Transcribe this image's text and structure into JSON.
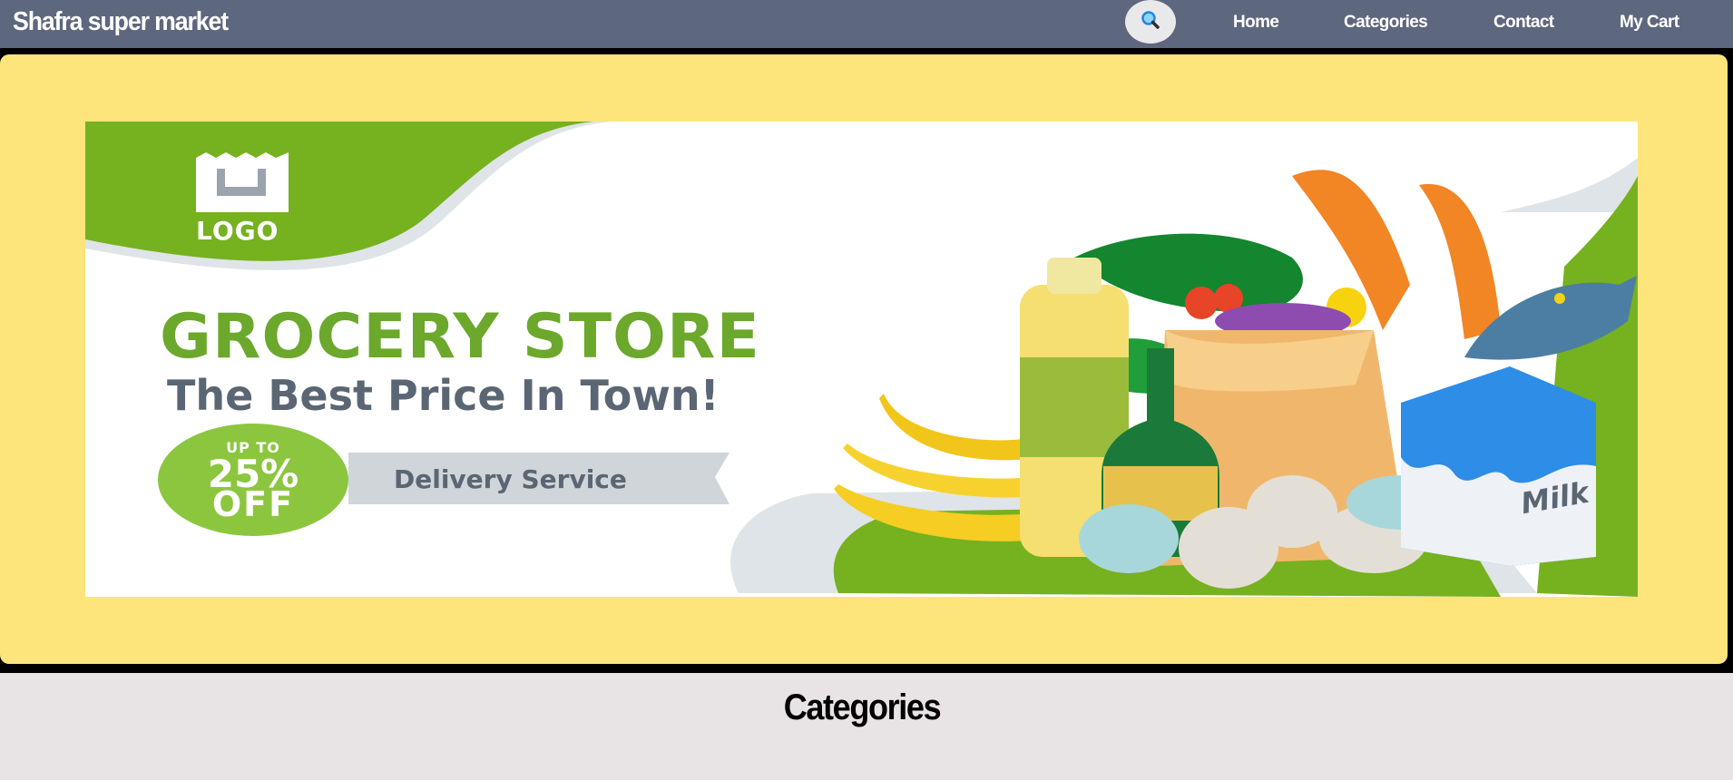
{
  "nav": {
    "brand": "Shafra super market",
    "search_icon": "magnifier-icon",
    "links": [
      "Home",
      "Categories",
      "Contact",
      "My Cart"
    ]
  },
  "hero": {
    "banner": {
      "logo": "LOGO",
      "headline": "GROCERY STORE",
      "subline": "The Best Price In Town!",
      "badge_up": "UP TO",
      "badge_percent": "25%",
      "badge_off": "OFF",
      "delivery": "Delivery Service",
      "milk_label": "Milk"
    }
  },
  "sections": {
    "categories_title": "Categories"
  },
  "colors": {
    "navbar": "#5d677e",
    "hero_bg": "#fde57c",
    "page_bg": "#e8e3e5",
    "banner_green": "#76b11f",
    "search_icon": "#1e88e5"
  }
}
